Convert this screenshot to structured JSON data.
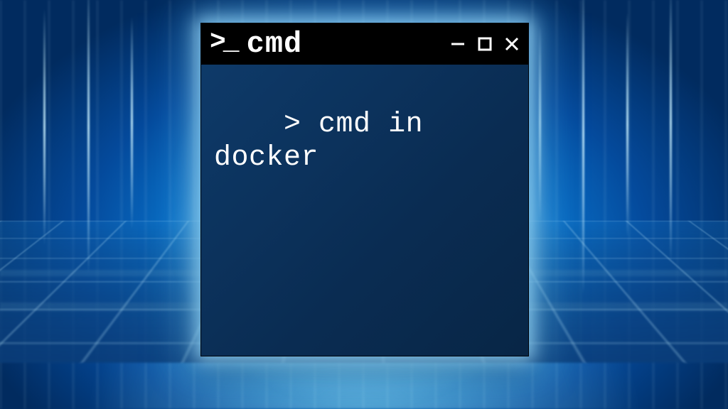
{
  "window": {
    "icon_label": "prompt-icon",
    "prompt_icon_text": ">_",
    "title": "cmd",
    "controls": {
      "minimize_label": "Minimize",
      "maximize_label": "Maximize",
      "close_label": "Close"
    }
  },
  "terminal": {
    "prompt": ">",
    "command": "cmd in docker"
  },
  "colors": {
    "titlebar_bg": "#000000",
    "titlebar_fg": "#ffffff",
    "body_bg": "#0b325d",
    "body_fg": "#ffffff",
    "glow": "#7fd3ff"
  }
}
